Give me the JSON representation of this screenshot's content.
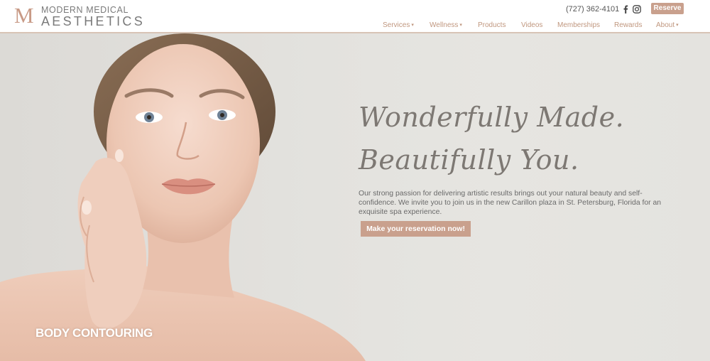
{
  "header": {
    "logo": {
      "monogram": "M",
      "line1": "MODERN MEDICAL",
      "line2": "AESTHETICS"
    },
    "phone": "(727) 362-4101",
    "social": [
      {
        "icon": "facebook-icon"
      },
      {
        "icon": "instagram-icon"
      }
    ],
    "reserve_label": "Reserve",
    "nav": [
      {
        "label": "Services",
        "dropdown": true
      },
      {
        "label": "Wellness",
        "dropdown": true
      },
      {
        "label": "Products",
        "dropdown": false
      },
      {
        "label": "Videos",
        "dropdown": false
      },
      {
        "label": "Memberships",
        "dropdown": false
      },
      {
        "label": "Rewards",
        "dropdown": false
      },
      {
        "label": "About",
        "dropdown": true
      }
    ],
    "dropdown_glyph": "▾"
  },
  "hero": {
    "headline_line1": "Wonderfully Made.",
    "headline_line2": "Beautifully You.",
    "body": "Our strong passion for delivering artistic results brings out your natural beauty and self-confidence. We invite you to join us in the new Carillon plaza in St. Petersburg, Florida for an exquisite spa experience.",
    "cta_label": "Make your reservation now!",
    "slide_label": "BODY CONTOURING"
  },
  "colors": {
    "accent": "#c9a08d",
    "nav_text": "#c0977f",
    "header_rule": "#d8c4b6",
    "headline": "#7d7873",
    "hero_background": "#e4e3df"
  }
}
